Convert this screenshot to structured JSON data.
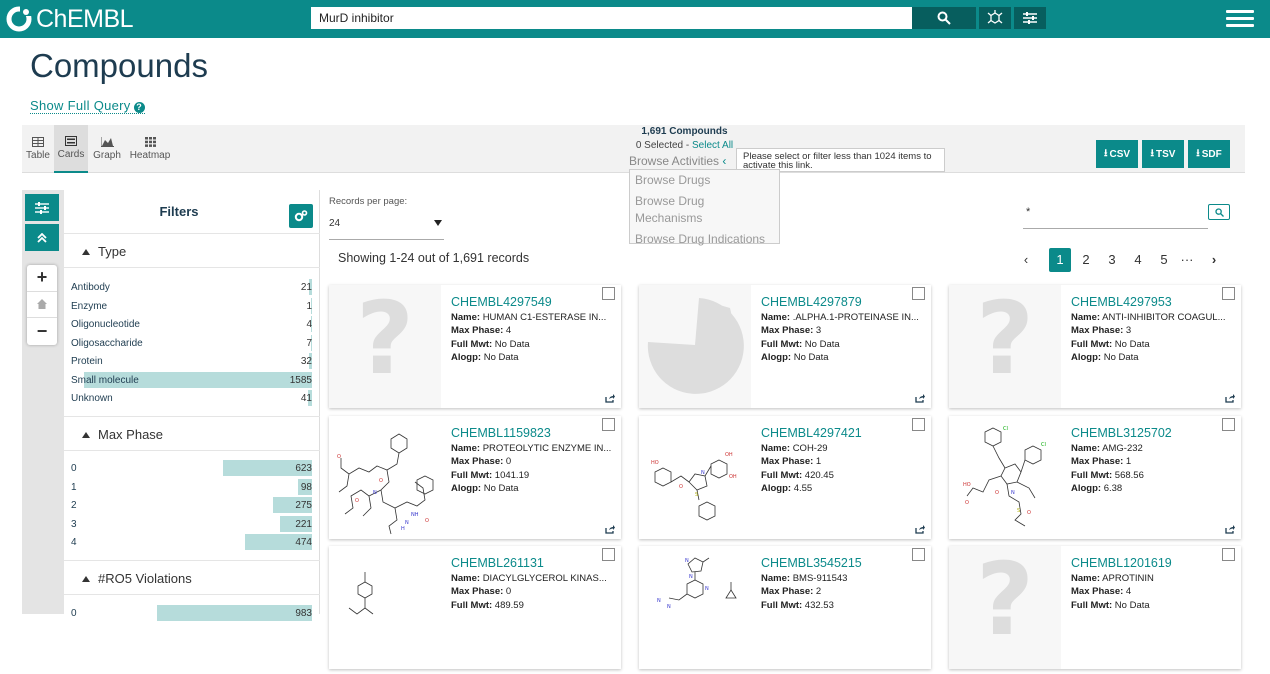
{
  "header": {
    "logo_text": "ChEMBL",
    "search_value": "MurD inhibitor",
    "accent": "#0b8a8a"
  },
  "page": {
    "title": "Compounds",
    "show_full_query": "Show Full Query"
  },
  "views": [
    {
      "label": "Table",
      "icon": "table-icon"
    },
    {
      "label": "Cards",
      "icon": "cards-icon",
      "selected": true
    },
    {
      "label": "Graph",
      "icon": "graph-icon"
    },
    {
      "label": "Heatmap",
      "icon": "heatmap-icon"
    }
  ],
  "selection": {
    "count_text": "1,691 Compounds",
    "selected_text": "0 Selected - ",
    "select_all": "Select All",
    "browse_activities": "Browse Activities",
    "tooltip": "Please select or filter less than 1024 items to activate this link.",
    "browse_menu": [
      "Browse Drugs",
      "Browse Drug Mechanisms",
      "Browse Drug Indications"
    ]
  },
  "downloads": [
    "CSV",
    "TSV",
    "SDF"
  ],
  "filters": {
    "title": "Filters",
    "sections": [
      {
        "name": "Type",
        "rows": [
          {
            "label": "Antibody",
            "count": "21"
          },
          {
            "label": "Enzyme",
            "count": "1"
          },
          {
            "label": "Oligonucleotide",
            "count": "4"
          },
          {
            "label": "Oligosaccharide",
            "count": "7"
          },
          {
            "label": "Protein",
            "count": "32"
          },
          {
            "label": "Small molecule",
            "count": "1585"
          },
          {
            "label": "Unknown",
            "count": "41"
          }
        ]
      },
      {
        "name": "Max Phase",
        "rows": [
          {
            "label": "0",
            "count": "623"
          },
          {
            "label": "1",
            "count": "98"
          },
          {
            "label": "2",
            "count": "275"
          },
          {
            "label": "3",
            "count": "221"
          },
          {
            "label": "4",
            "count": "474"
          }
        ]
      },
      {
        "name": "#RO5 Violations",
        "rows": [
          {
            "label": "0",
            "count": "983"
          }
        ]
      }
    ]
  },
  "records": {
    "per_page_label": "Records per page:",
    "per_page_value": "24",
    "showing": "Showing 1-24 out of 1,691 records",
    "search_value": "*"
  },
  "pagination": {
    "pages": [
      "1",
      "2",
      "3",
      "4",
      "5"
    ],
    "ellipsis": "···",
    "active": "1"
  },
  "field_labels": {
    "name": "Name:",
    "phase": "Max Phase:",
    "mwt": "Full Mwt:",
    "alogp": "Alogp:"
  },
  "cards": [
    {
      "id": "CHEMBL4297549",
      "name": "HUMAN C1-ESTERASE IN...",
      "phase": "4",
      "mwt": "No Data",
      "alogp": "No Data",
      "image": "question-placeholder"
    },
    {
      "id": "CHEMBL4297879",
      "name": ".ALPHA.1-PROTEINASE IN...",
      "phase": "3",
      "mwt": "No Data",
      "alogp": "No Data",
      "image": "protein-placeholder"
    },
    {
      "id": "CHEMBL4297953",
      "name": "ANTI-INHIBITOR COAGUL...",
      "phase": "3",
      "mwt": "No Data",
      "alogp": "No Data",
      "image": "question-placeholder"
    },
    {
      "id": "CHEMBL1159823",
      "name": "PROTEOLYTIC ENZYME IN...",
      "phase": "0",
      "mwt": "1041.19",
      "alogp": "No Data",
      "image": "structure"
    },
    {
      "id": "CHEMBL4297421",
      "name": "COH-29",
      "phase": "1",
      "mwt": "420.45",
      "alogp": "4.55",
      "image": "structure"
    },
    {
      "id": "CHEMBL3125702",
      "name": "AMG-232",
      "phase": "1",
      "mwt": "568.56",
      "alogp": "6.38",
      "image": "structure"
    },
    {
      "id": "CHEMBL261131",
      "name": "DIACYLGLYCEROL KINAS...",
      "phase": "0",
      "mwt": "489.59",
      "alogp": "",
      "image": "structure"
    },
    {
      "id": "CHEMBL3545215",
      "name": "BMS-911543",
      "phase": "2",
      "mwt": "432.53",
      "alogp": "",
      "image": "structure"
    },
    {
      "id": "CHEMBL1201619",
      "name": "APROTININ",
      "phase": "4",
      "mwt": "No Data",
      "alogp": "",
      "image": "question-placeholder"
    }
  ]
}
